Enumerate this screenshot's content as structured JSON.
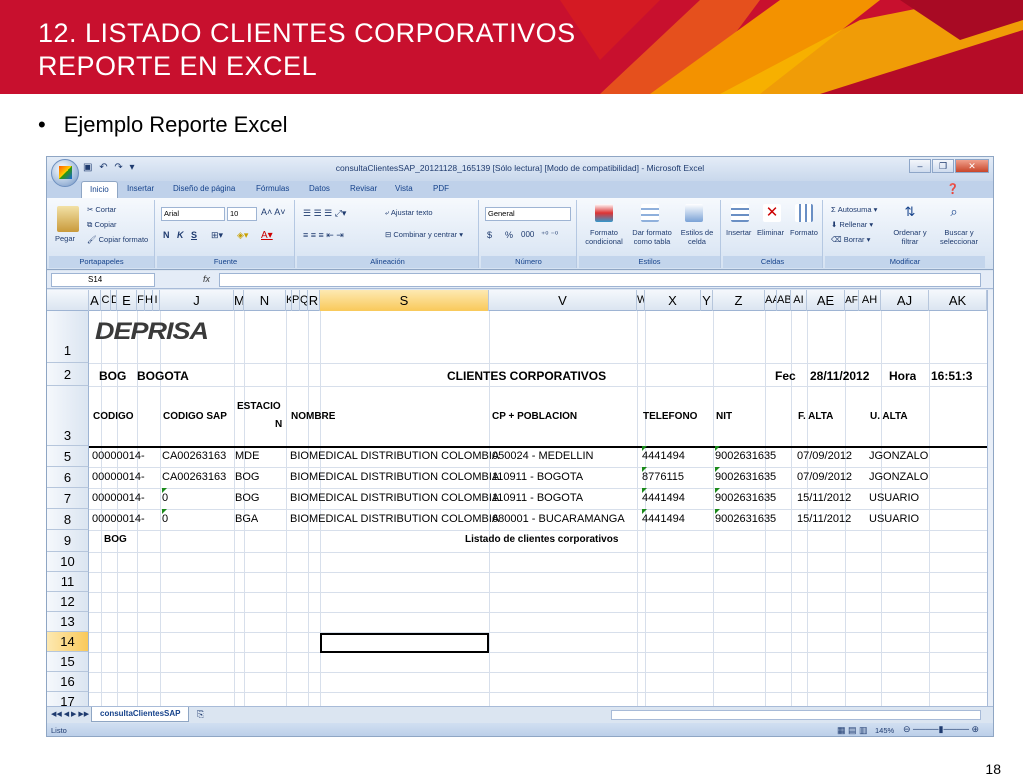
{
  "slide": {
    "title_line1": "12.  LISTADO CLIENTES CORPORATIVOS",
    "title_line2": "REPORTE EN EXCEL",
    "bullet": "Ejemplo  Reporte Excel",
    "page_number": "18",
    "colors": {
      "banner": "#c8102e",
      "accent_orange": "#f39200"
    }
  },
  "excel": {
    "window_title": "consultaClientesSAP_20121128_165139  [Sólo lectura]  [Modo de compatibilidad] - Microsoft Excel",
    "tabs": [
      "Inicio",
      "Insertar",
      "Diseño de página",
      "Fórmulas",
      "Datos",
      "Revisar",
      "Vista",
      "PDF"
    ],
    "active_tab": "Inicio",
    "ribbon": {
      "portapapeles": {
        "label": "Portapapeles",
        "paste": "Pegar",
        "cut": "Cortar",
        "copy": "Copiar",
        "format_painter": "Copiar formato"
      },
      "fuente": {
        "label": "Fuente",
        "font": "Arial",
        "size": "10",
        "bold": "N",
        "italic": "K",
        "underline": "S"
      },
      "alineacion": {
        "label": "Alineación",
        "wrap": "Ajustar texto",
        "merge": "Combinar y centrar"
      },
      "numero": {
        "label": "Número",
        "format": "General",
        "currency": "$",
        "percent": "%",
        "thousands": "000"
      },
      "estilos": {
        "label": "Estilos",
        "conditional": "Formato condicional",
        "table": "Dar formato como tabla",
        "cell_styles": "Estilos de celda"
      },
      "celdas": {
        "label": "Celdas",
        "insert": "Insertar",
        "delete": "Eliminar",
        "format": "Formato"
      },
      "modificar": {
        "label": "Modificar",
        "autosum": "Autosuma",
        "fill": "Rellenar",
        "clear": "Borrar",
        "sort": "Ordenar y filtrar",
        "find": "Buscar y seleccionar"
      }
    },
    "name_box": "S14",
    "fx": "fx",
    "columns": [
      "A",
      "C",
      "D",
      "E",
      "F",
      "H",
      "I",
      "J",
      "M",
      "N",
      "K",
      "P",
      "Q",
      "R",
      "S",
      "V",
      "W",
      "X",
      "Y",
      "Z",
      "AA",
      "AB",
      "AI",
      "AE",
      "AF",
      "AH",
      "AJ",
      "AK"
    ],
    "rows": [
      "1",
      "2",
      "3",
      "5",
      "6",
      "7",
      "8",
      "9",
      "10",
      "11",
      "12",
      "13",
      "14",
      "15",
      "16",
      "17"
    ],
    "header_row2": {
      "code": "BOG",
      "city": "BOGOTA",
      "report": "CLIENTES CORPORATIVOS",
      "date_label": "Fec",
      "date": "28/11/2012",
      "time_label": "Hora",
      "time": "16:51:3"
    },
    "logo": "DEPRISA",
    "table_headers": [
      "CÓDIGO",
      "CÓDIGO SAP",
      "ESTACIÓ",
      "N",
      "NOMBRE",
      "CP + POBLACIÓN",
      "TELEFONO",
      "NIT",
      "F. ALTA",
      "U. ALTA"
    ],
    "data_rows": [
      {
        "codigo": "00000014-",
        "sap": "CA00263163",
        "estacion": "MDE",
        "nombre": "BIOMEDICAL DISTRIBUTION COLOMBIA",
        "cp": "050024 - MEDELLIN",
        "tel": "4441494",
        "nit": "9002631635",
        "alta": "07/09/2012",
        "usuario": "JGONZALO"
      },
      {
        "codigo": "00000014-",
        "sap": "CA00263163",
        "estacion": "BOG",
        "nombre": "BIOMEDICAL DISTRIBUTION COLOMBIA",
        "cp": "110911 - BOGOTA",
        "tel": "8776115",
        "nit": "9002631635",
        "alta": "07/09/2012",
        "usuario": "JGONZALO"
      },
      {
        "codigo": "00000014-",
        "sap": "0",
        "estacion": "BOG",
        "nombre": "BIOMEDICAL DISTRIBUTION COLOMBIA",
        "cp": "110911 - BOGOTA",
        "tel": "4441494",
        "nit": "9002631635",
        "alta": "15/11/2012",
        "usuario": "USUARIO"
      },
      {
        "codigo": "00000014-",
        "sap": "0",
        "estacion": "BGA",
        "nombre": "BIOMEDICAL DISTRIBUTION COLOMBIA",
        "cp": "680001 - BUCARAMANGA",
        "tel": "4441494",
        "nit": "9002631635",
        "alta": "15/11/2012",
        "usuario": "USUARIO"
      }
    ],
    "footer_row": {
      "code": "BOG",
      "text": "Listado de clientes corporativos"
    },
    "sheet_tab": "consultaClientesSAP",
    "status": "Listo",
    "zoom": "145%"
  }
}
